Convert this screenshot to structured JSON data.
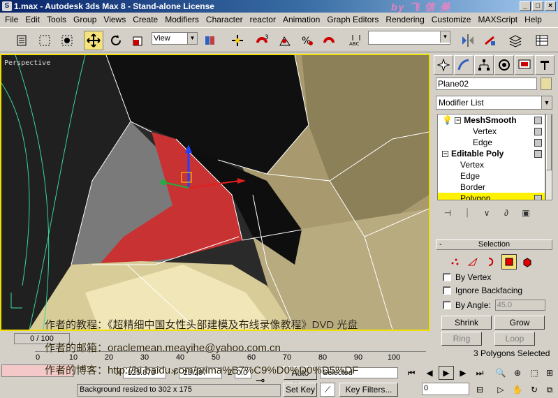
{
  "window": {
    "icon_letter": "S",
    "title": "1.max - Autodesk 3ds Max 8 - Stand-alone License",
    "logo_text": "by 飞 信 美",
    "controls": [
      "_",
      "□",
      "×"
    ]
  },
  "menu": [
    "File",
    "Edit",
    "Tools",
    "Group",
    "Views",
    "Create",
    "Modifiers",
    "Character",
    "reactor",
    "Animation",
    "Graph Editors",
    "Rendering",
    "Customize",
    "MAXScript",
    "Help"
  ],
  "toolbar": {
    "view_dropdown": "View",
    "selection_set": "",
    "icons": [
      "undo-icon",
      "select-object-icon",
      "select-region-icon",
      "select-filter-icon",
      "select-move-icon",
      "select-rotate-icon",
      "select-scale-icon",
      "reference-coord-icon",
      "pivot-icon",
      "snap-3d-icon",
      "angle-snap-icon",
      "percent-snap-icon",
      "spinner-snap-icon",
      "named-selection-icon",
      "mirror-icon",
      "align-icon",
      "layer-icon",
      "curve-editor-icon"
    ]
  },
  "viewport": {
    "label": "Perspective",
    "active_border_color": "#f0e000",
    "selected_face_color": "#c83232"
  },
  "command_panel": {
    "tabs": [
      "create-icon",
      "modify-icon",
      "hierarchy-icon",
      "motion-icon",
      "display-icon",
      "utilities-icon"
    ],
    "object_name": "Plane02",
    "object_color": "#e8dca0",
    "modifier_list": "Modifier List",
    "stack": [
      {
        "label": "MeshSmooth",
        "bold": true,
        "toggle": "−"
      },
      {
        "label": "Vertex",
        "bold": false
      },
      {
        "label": "Edge",
        "bold": false
      },
      {
        "label": "Editable Poly",
        "bold": true,
        "toggle": "−"
      },
      {
        "label": "Vertex",
        "bold": false
      },
      {
        "label": "Edge",
        "bold": false
      },
      {
        "label": "Border",
        "bold": false
      },
      {
        "label": "Polygon",
        "bold": false,
        "highlighted": true
      }
    ],
    "selection": {
      "title": "Selection",
      "by_vertex": "By Vertex",
      "ignore_backfacing": "Ignore Backfacing",
      "by_angle": "By Angle:",
      "angle_value": "45.0",
      "shrink": "Shrink",
      "grow": "Grow",
      "ring": "Ring",
      "loop": "Loop",
      "status": "3 Polygons Selected"
    }
  },
  "overlay": {
    "line1": "作者的教程：《超精细中国女性头部建模及布线录像教程》DVD 光盘",
    "line2": "作者的邮箱：oraclemean.meayihe@yahoo.com.cn",
    "line3": "作者的博客：http://hi.baidu.com/prima%B7%C9%D0%D0%D5%DF"
  },
  "timeline": {
    "slider": "0 / 100",
    "ticks": [
      "0",
      "10",
      "20",
      "30",
      "40",
      "50",
      "60",
      "70",
      "80",
      "90",
      "100"
    ]
  },
  "status": {
    "x_label": "X",
    "x_value": "-125.873",
    "y_label": "Y",
    "y_value": "-23.297",
    "z_label": "Z",
    "z_value": "0.0",
    "prompt": "Background resized to 302 x 175",
    "auto_key": "Auto Key",
    "set_key": "Set Key",
    "selected": "Selected",
    "key_filters": "Key Filters...",
    "frame": "0"
  }
}
